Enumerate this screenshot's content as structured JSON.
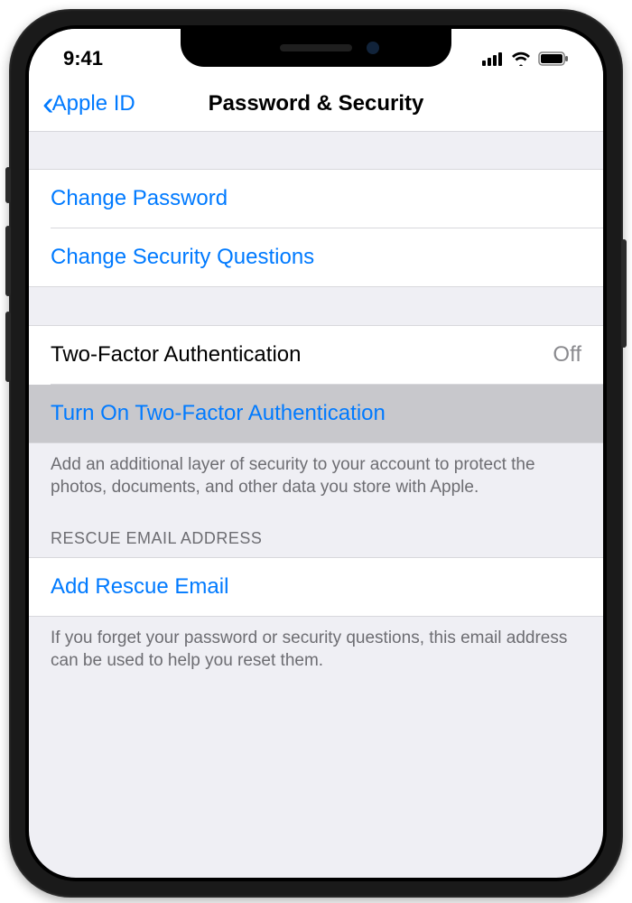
{
  "status": {
    "time": "9:41"
  },
  "nav": {
    "back_label": "Apple ID",
    "title": "Password & Security"
  },
  "rows": {
    "change_password": "Change Password",
    "change_security_questions": "Change Security Questions",
    "two_factor_label": "Two-Factor Authentication",
    "two_factor_value": "Off",
    "turn_on_2fa": "Turn On Two-Factor Authentication",
    "two_factor_footer": "Add an additional layer of security to your account to protect the photos, documents, and other data you store with Apple.",
    "rescue_header": "RESCUE EMAIL ADDRESS",
    "add_rescue_email": "Add Rescue Email",
    "rescue_footer": "If you forget your password or security questions, this email address can be used to help you reset them."
  }
}
